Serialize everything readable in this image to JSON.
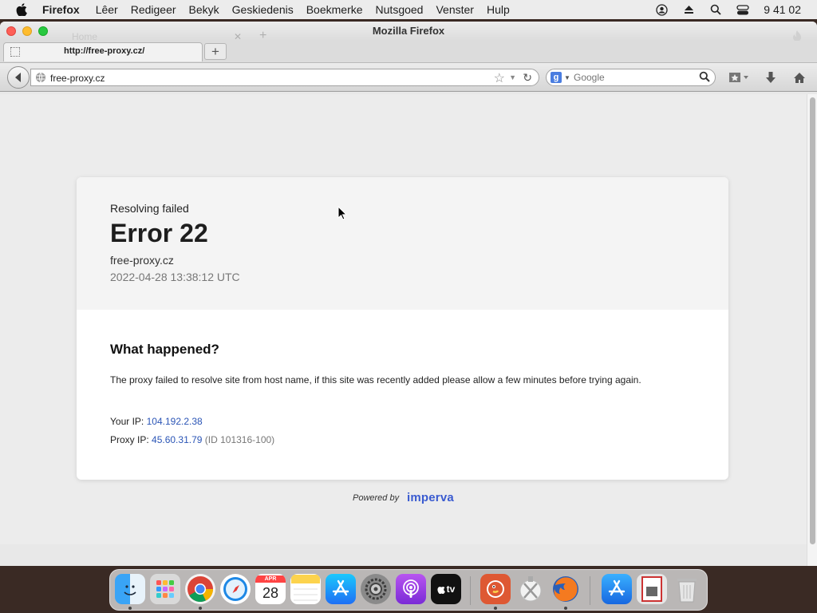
{
  "menubar": {
    "app": "Firefox",
    "items": [
      "Lêer",
      "Redigeer",
      "Bekyk",
      "Geskiedenis",
      "Boekmerke",
      "Nutsgoed",
      "Venster",
      "Hulp"
    ],
    "clock": "9 41 02"
  },
  "window": {
    "title": "Mozilla Firefox",
    "ghost_tab_label": "Home"
  },
  "tabs": {
    "active_label": "http://free-proxy.cz/",
    "new_tab": "+"
  },
  "navbar": {
    "url": "free-proxy.cz",
    "search_placeholder": "Google",
    "search_engine_letter": "g"
  },
  "page": {
    "status": "Resolving failed",
    "error_code": "Error 22",
    "host": "free-proxy.cz",
    "timestamp": "2022-04-28 13:38:12 UTC",
    "heading": "What happened?",
    "description": "The proxy failed to resolve site from host name, if this site was recently added please allow a few minutes before trying again.",
    "your_ip_label": "Your IP:",
    "your_ip": "104.192.2.38",
    "proxy_ip_label": "Proxy IP:",
    "proxy_ip": "45.60.31.79",
    "proxy_id": "(ID 101316-100)",
    "powered_by": "Powered by",
    "brand": "imperva"
  },
  "dock": {
    "calendar_month": "APR",
    "calendar_day": "28",
    "tv_label": "tv"
  },
  "colors": {
    "link": "#2b55b6",
    "brand": "#3a5bd0"
  }
}
